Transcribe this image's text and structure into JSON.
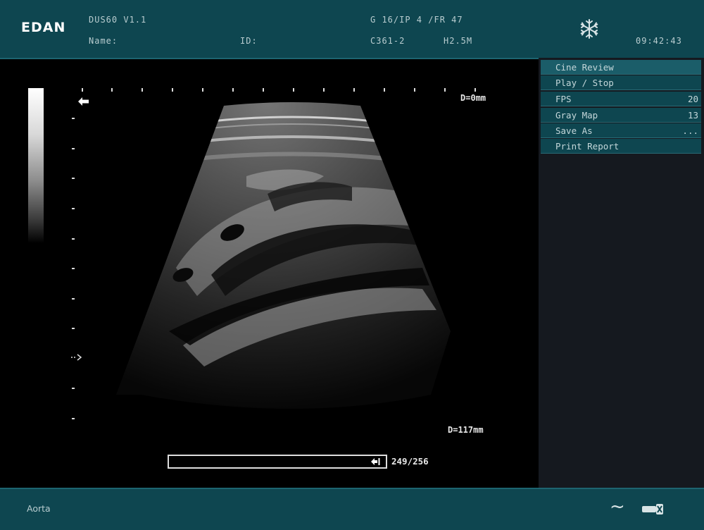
{
  "header": {
    "logo": "EDAN",
    "version": "DUS60 V1.1",
    "name_label": "Name:",
    "id_label": "ID:",
    "params": "G 16/IP 4 /FR 47",
    "probe": "C361-2",
    "frequency": "H2.5M",
    "time": "09:42:43",
    "freeze_icon": "snowflake-icon"
  },
  "menu": {
    "title": "Cine Review",
    "items": [
      {
        "label": "Play / Stop",
        "value": ""
      },
      {
        "label": "FPS",
        "value": "20"
      },
      {
        "label": "Gray Map",
        "value": "13"
      },
      {
        "label": "Save As",
        "value": "..."
      },
      {
        "label": "Print Report",
        "value": ""
      }
    ]
  },
  "scan": {
    "depth_top": "D=0mm",
    "depth_bottom": "D=117mm",
    "frame_counter": "249/256",
    "cine_position": 0.973
  },
  "footer": {
    "annotation": "Aorta",
    "wave_icon": "tilde-icon",
    "probe_icon": "probe-icon"
  },
  "colors": {
    "panel": "#0e4650",
    "menu_bg": "#15191f",
    "text": "#b9cdd0"
  }
}
